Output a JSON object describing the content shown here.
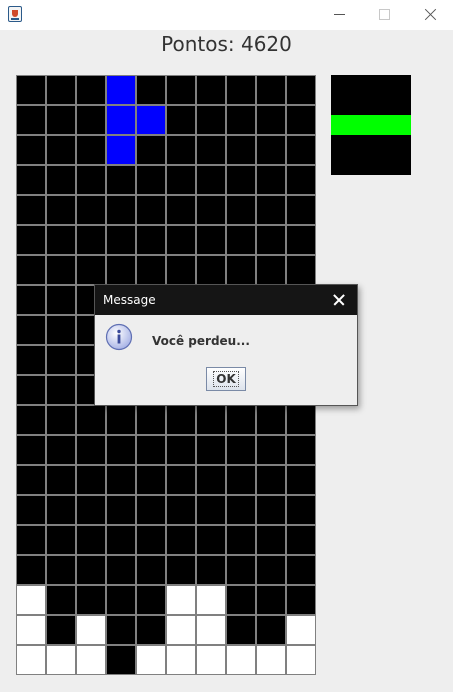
{
  "window": {
    "title": "",
    "controls": [
      "minimize",
      "maximize",
      "close"
    ]
  },
  "score": {
    "text": "Pontos: 4620"
  },
  "board": {
    "columns": 10,
    "rows": 20,
    "empty_color": "#000000",
    "grid_color": "#808080",
    "filled_cells": [
      {
        "row": 0,
        "col": 3,
        "color": "#0000ff"
      },
      {
        "row": 1,
        "col": 3,
        "color": "#0000ff"
      },
      {
        "row": 1,
        "col": 4,
        "color": "#0000ff"
      },
      {
        "row": 2,
        "col": 3,
        "color": "#0000ff"
      },
      {
        "row": 17,
        "col": 0,
        "color": "#ffffff"
      },
      {
        "row": 17,
        "col": 5,
        "color": "#ffffff"
      },
      {
        "row": 17,
        "col": 6,
        "color": "#ffffff"
      },
      {
        "row": 18,
        "col": 0,
        "color": "#ffffff"
      },
      {
        "row": 18,
        "col": 2,
        "color": "#ffffff"
      },
      {
        "row": 18,
        "col": 5,
        "color": "#ffffff"
      },
      {
        "row": 18,
        "col": 6,
        "color": "#ffffff"
      },
      {
        "row": 18,
        "col": 9,
        "color": "#ffffff"
      },
      {
        "row": 19,
        "col": 0,
        "color": "#ffffff"
      },
      {
        "row": 19,
        "col": 1,
        "color": "#ffffff"
      },
      {
        "row": 19,
        "col": 2,
        "color": "#ffffff"
      },
      {
        "row": 19,
        "col": 4,
        "color": "#ffffff"
      },
      {
        "row": 19,
        "col": 5,
        "color": "#ffffff"
      },
      {
        "row": 19,
        "col": 6,
        "color": "#ffffff"
      },
      {
        "row": 19,
        "col": 7,
        "color": "#ffffff"
      },
      {
        "row": 19,
        "col": 8,
        "color": "#ffffff"
      },
      {
        "row": 19,
        "col": 9,
        "color": "#ffffff"
      }
    ]
  },
  "next_piece": {
    "background": "#000000",
    "piece_color": "#00ff00"
  },
  "dialog": {
    "title": "Message",
    "message": "Você perdeu...",
    "ok_label": "OK",
    "icon": "info-icon"
  }
}
